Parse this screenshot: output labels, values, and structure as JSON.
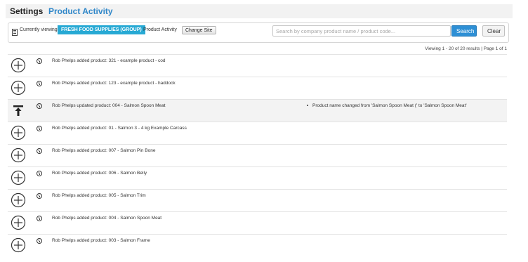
{
  "header": {
    "settings_label": "Settings",
    "page_title": "Product Activity"
  },
  "toolbar": {
    "currently_viewing_label": "Currently viewing",
    "group_name": "FRESH FOOD SUPPLIES (GROUP)",
    "page_label": "Product Activity",
    "change_site_label": "Change Site",
    "search_placeholder": "Search by company product name / product code...",
    "search_value": "",
    "search_label": "Search",
    "clear_label": "Clear"
  },
  "results_summary": "Viewing 1 - 20 of 20 results | Page 1 of 1",
  "colors": {
    "accent": "#2f87c9",
    "badge": "#27a9d4",
    "search_button": "#2d8fd5"
  },
  "activity": [
    {
      "icon": "plus-circle-icon",
      "text": "Rob Phelps added product: 321 - example product - cod",
      "detail": ""
    },
    {
      "icon": "plus-circle-icon",
      "text": "Rob Phelps added product: 123 - example product - haddock",
      "detail": ""
    },
    {
      "icon": "update-arrow-icon",
      "text": "Rob Phelps updated product: 004 - Salmon Spoon Meat",
      "detail": "Product name changed from 'Salmon Spoon Meat (' to 'Salmon Spoon Meat'"
    },
    {
      "icon": "plus-circle-icon",
      "text": "Rob Phelps added product: 01 - Salmon 3 - 4 kg Example Carcass",
      "detail": ""
    },
    {
      "icon": "plus-circle-icon",
      "text": "Rob Phelps added product: 007 - Salmon Pin Bone",
      "detail": ""
    },
    {
      "icon": "plus-circle-icon",
      "text": "Rob Phelps added product: 006 - Salmon Belly",
      "detail": ""
    },
    {
      "icon": "plus-circle-icon",
      "text": "Rob Phelps added product: 005 - Salmon Trim",
      "detail": ""
    },
    {
      "icon": "plus-circle-icon",
      "text": "Rob Phelps added product: 004 - Salmon Spoon Meat",
      "detail": ""
    },
    {
      "icon": "plus-circle-icon",
      "text": "Rob Phelps added product: 003 - Salmon Frame",
      "detail": ""
    }
  ]
}
